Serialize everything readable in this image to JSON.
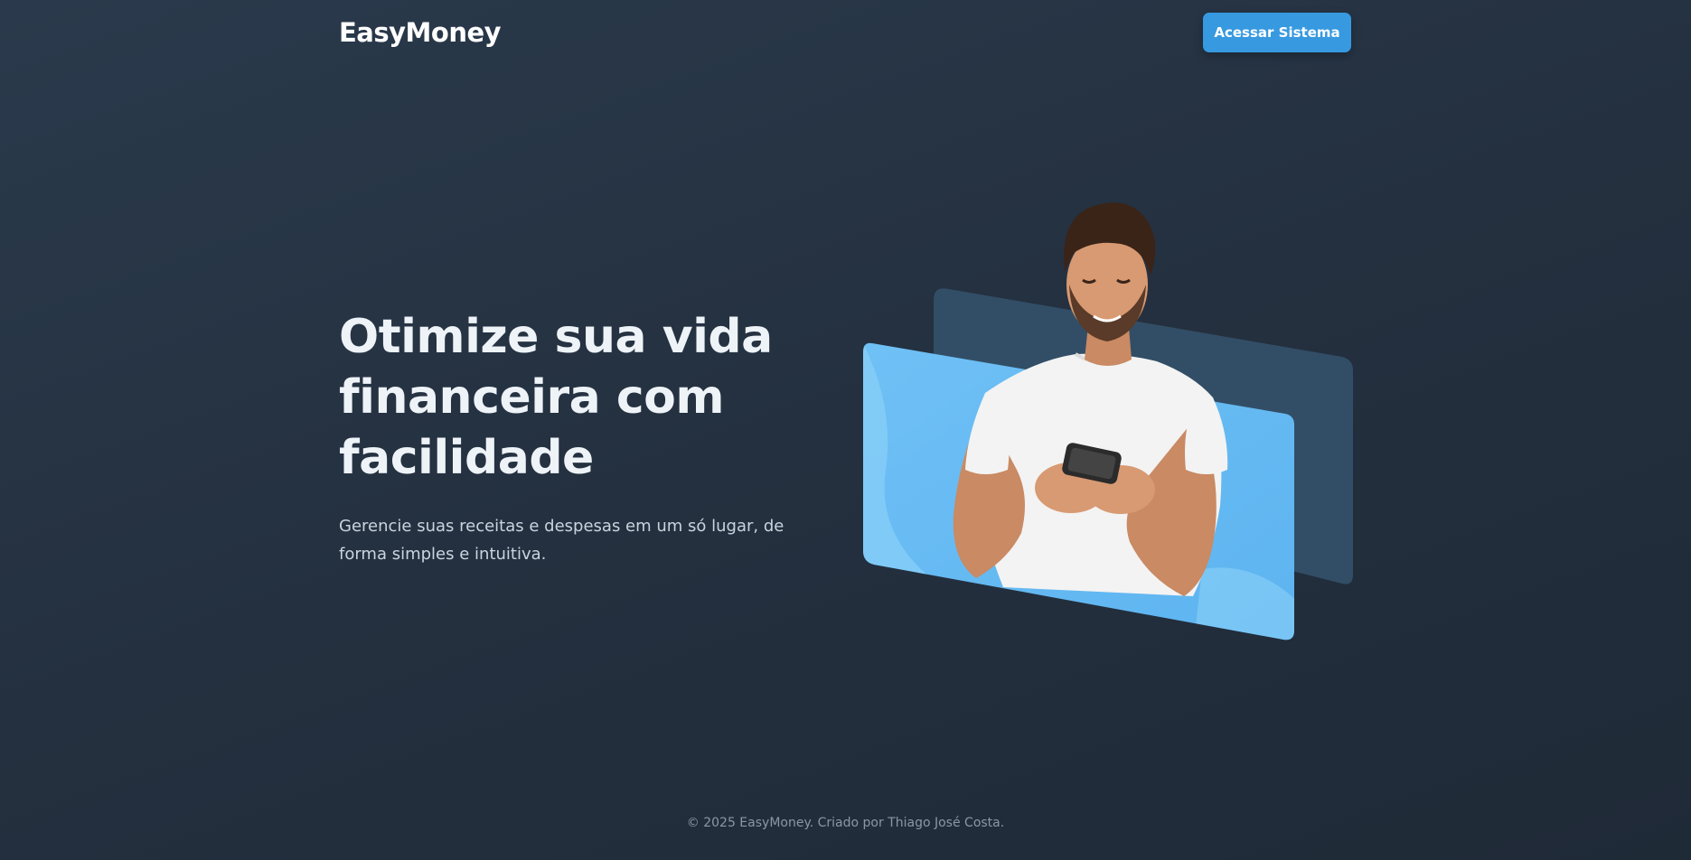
{
  "header": {
    "brand": "EasyMoney",
    "cta_label": "Acessar Sistema"
  },
  "hero": {
    "headline": "Otimize sua vida financeira com facilidade",
    "subtext": "Gerencie suas receitas e despesas em um só lugar, de forma simples e intuitiva.",
    "image_icon": "person-with-phone-illustration"
  },
  "footer": {
    "copyright": "© 2025 EasyMoney. Criado por Thiago José Costa."
  },
  "colors": {
    "background": "#24303f",
    "accent": "#3799e0",
    "card_light": "#63b8f2",
    "card_dark": "#35536d"
  }
}
